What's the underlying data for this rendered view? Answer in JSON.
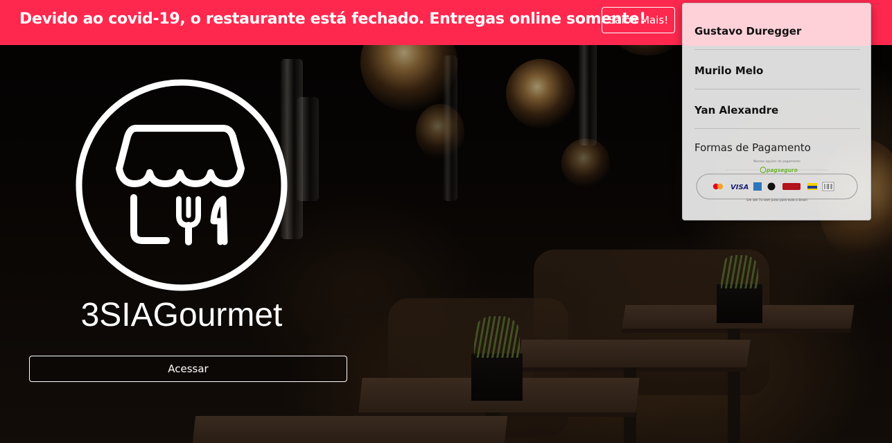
{
  "banner": {
    "message": "Devido ao covid-19, o restaurante está fechado. Entregas online somente!",
    "more_button": "Saiba Mais!"
  },
  "menu": {
    "items": [
      {
        "label": "Gustavo Duregger"
      },
      {
        "label": "Murilo Melo"
      },
      {
        "label": "Yan Alexandre"
      }
    ],
    "payment_heading": "Formas de Pagamento",
    "payment_image": {
      "caption_top": "Nossas opções de pagamento",
      "brand": "pagseguro",
      "caption_bottom": "Em até 7x sem juros para todo o Brasil"
    }
  },
  "hero": {
    "logo_icon": "store-cutlery-icon",
    "brand_name": "3SIAGourmet",
    "access_button": "Acessar"
  },
  "colors": {
    "banner": "#fe284e",
    "highlight": "#fed1d9",
    "white": "#ffffff"
  }
}
